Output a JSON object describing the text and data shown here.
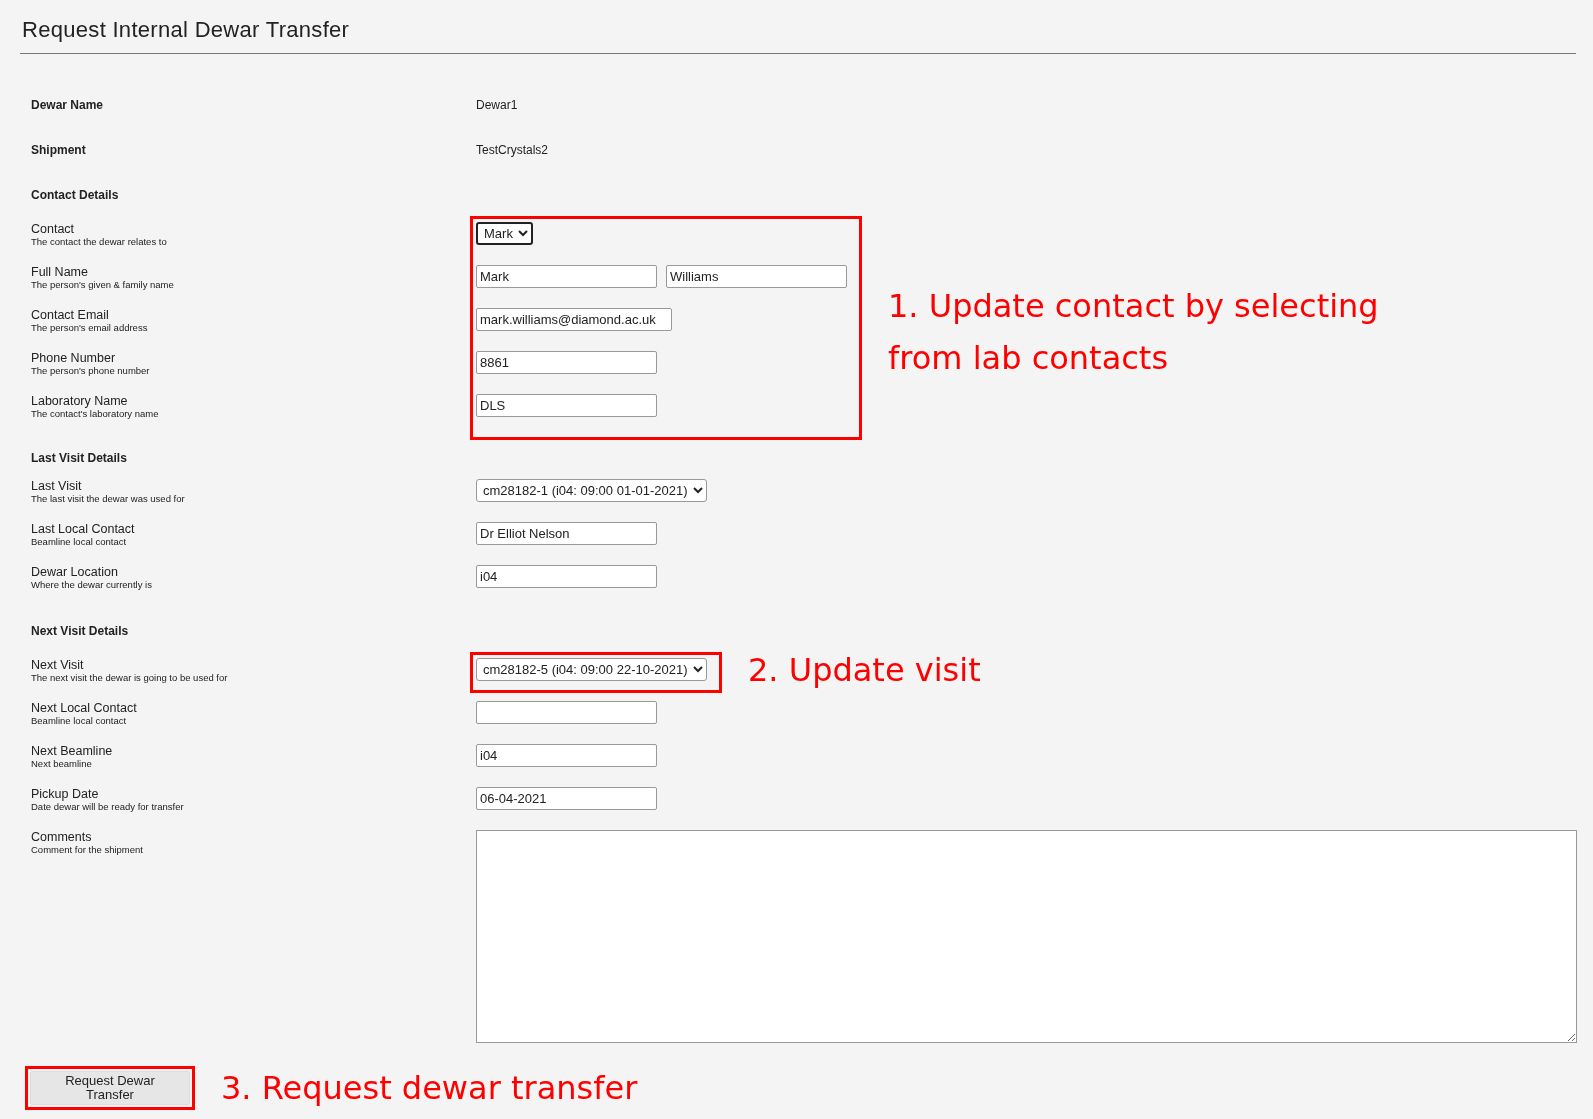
{
  "title": "Request Internal Dewar Transfer",
  "info": [
    {
      "label": "Dewar Name",
      "value": "Dewar1"
    },
    {
      "label": "Shipment",
      "value": "TestCrystals2"
    }
  ],
  "sections": [
    {
      "heading": "Contact Details",
      "groups": [
        {
          "annotation": "1. Update contact by selecting from lab contacts",
          "fields": [
            {
              "kind": "select",
              "label": "Contact",
              "hint": "The contact the dewar relates to",
              "value": "Mark",
              "focused": true
            },
            {
              "kind": "name",
              "label": "Full Name",
              "hint": "The person's given & family name",
              "values": [
                "Mark",
                "Williams"
              ]
            },
            {
              "kind": "text",
              "label": "Contact Email",
              "hint": "The person's email address",
              "value": "mark.williams@diamond.ac.uk"
            },
            {
              "kind": "text",
              "label": "Phone Number",
              "hint": "The person's phone number",
              "value": "8861"
            },
            {
              "kind": "text",
              "label": "Laboratory Name",
              "hint": "The contact's laboratory name",
              "value": "DLS"
            }
          ]
        }
      ]
    },
    {
      "heading": "Last Visit Details",
      "groups": [
        {
          "fields": [
            {
              "kind": "select",
              "label": "Last Visit",
              "hint": "The last visit the dewar was used for",
              "value": "cm28182-1 (i04: 09:00 01-01-2021)",
              "focused": false
            },
            {
              "kind": "text",
              "label": "Last Local Contact",
              "hint": "Beamline local contact",
              "value": "Dr Elliot Nelson"
            },
            {
              "kind": "text",
              "label": "Dewar Location",
              "hint": "Where the dewar currently is",
              "value": "i04"
            }
          ]
        }
      ]
    },
    {
      "heading": "Next Visit Details",
      "groups": [
        {
          "annotation": "2. Update visit",
          "fields": [
            {
              "kind": "select",
              "label": "Next Visit",
              "hint": "The next visit the dewar is going to be used for",
              "value": "cm28182-5 (i04: 09:00 22-10-2021)",
              "focused": false
            }
          ]
        },
        {
          "fields": [
            {
              "kind": "text",
              "label": "Next Local Contact",
              "hint": "Beamline local contact"
            },
            {
              "kind": "text",
              "label": "Next Beamline",
              "hint": "Next beamline",
              "value": "i04"
            },
            {
              "kind": "text",
              "label": "Pickup Date",
              "hint": "Date dewar will be ready for transfer",
              "value": "06-04-2021"
            },
            {
              "kind": "textarea",
              "label": "Comments",
              "hint": "Comment for the shipment"
            }
          ]
        }
      ]
    }
  ],
  "submit": {
    "label": "Request Dewar Transfer",
    "annotation": "3. Request dewar transfer"
  }
}
